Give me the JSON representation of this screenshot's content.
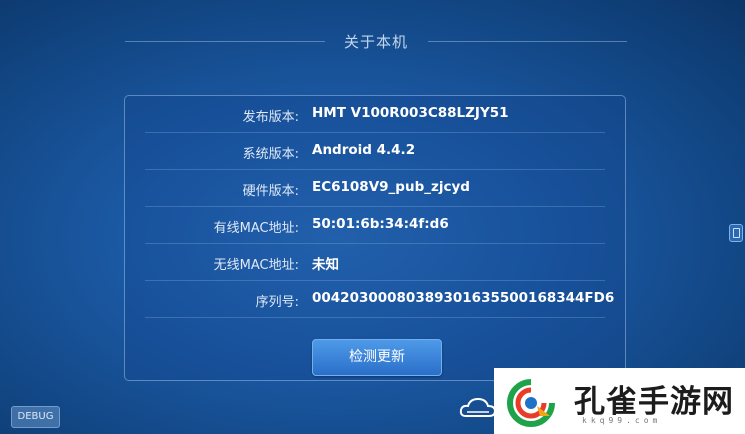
{
  "header": {
    "title": "关于本机"
  },
  "info_rows": [
    {
      "label": "发布版本:",
      "value": "HMT V100R003C88LZJY51"
    },
    {
      "label": "系统版本:",
      "value": "Android 4.4.2"
    },
    {
      "label": "硬件版本:",
      "value": "EC6108V9_pub_zjcyd"
    },
    {
      "label": "有线MAC地址:",
      "value": "50:01:6b:34:4f:d6"
    },
    {
      "label": "无线MAC地址:",
      "value": "未知"
    },
    {
      "label": "序列号:",
      "value": "00420300080389301635500168344FD6"
    }
  ],
  "actions": {
    "check_update": "检测更新",
    "debug": "DEBUG"
  },
  "watermark": {
    "brand": "孔雀手游网",
    "url": "kkq99.com"
  },
  "colors": {
    "background": "#1c5aa6",
    "button": "#3a85dc",
    "panel_border": "#96bee9"
  }
}
